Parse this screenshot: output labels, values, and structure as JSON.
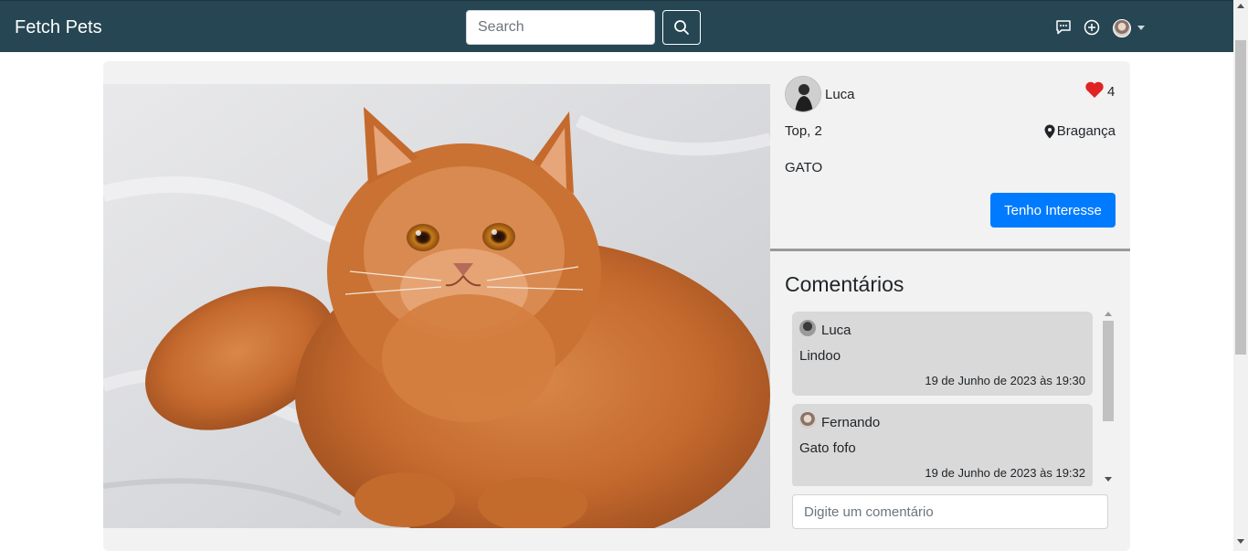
{
  "navbar": {
    "brand": "Fetch Pets",
    "search_placeholder": "Search",
    "icons": [
      "search-icon",
      "chat-icon",
      "add-circle-icon",
      "user-avatar",
      "caret-down-icon"
    ]
  },
  "post": {
    "owner": "Luca",
    "likes": "4",
    "pet_line": "Top, 2",
    "location": "Bragança",
    "species": "GATO",
    "interest_button": "Tenho Interesse"
  },
  "comments": {
    "title": "Comentários",
    "items": [
      {
        "author": "Luca",
        "text": "Lindoo",
        "date": "19 de Junho de 2023 às 19:30"
      },
      {
        "author": "Fernando",
        "text": "Gato fofo",
        "date": "19 de Junho de 2023 às 19:32"
      }
    ],
    "input_placeholder": "Digite um comentário"
  },
  "colors": {
    "navbar": "#264653",
    "primary_button": "#007bff",
    "heart": "#e02424",
    "card_bg": "#f2f2f2",
    "comment_bg": "#d9d9d9"
  }
}
